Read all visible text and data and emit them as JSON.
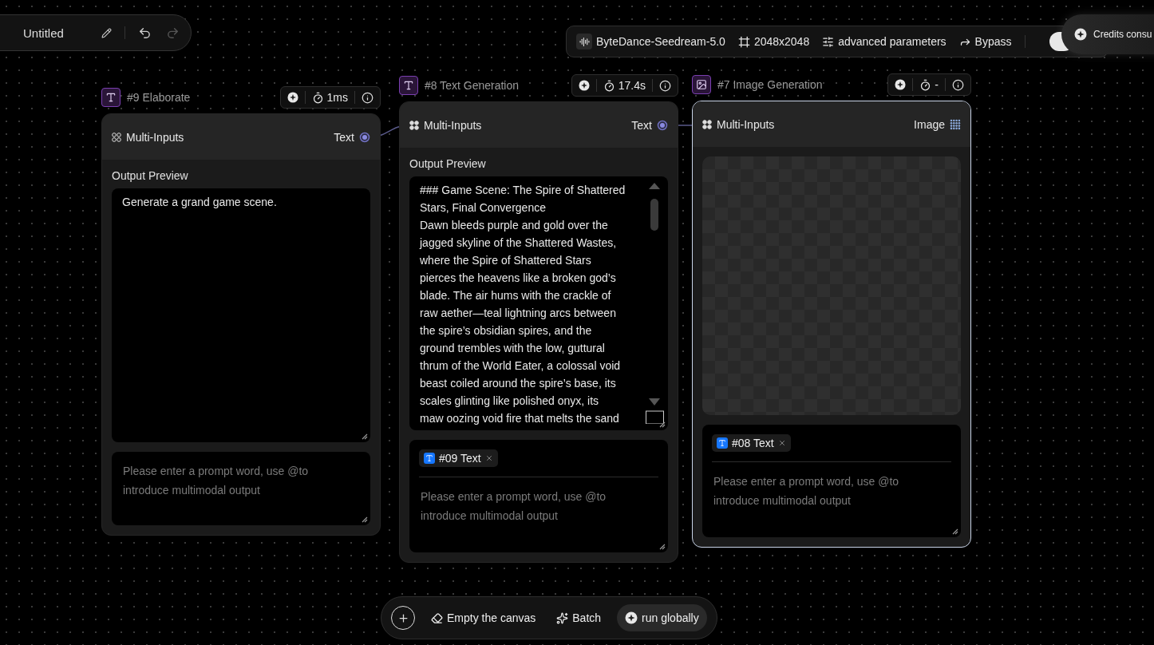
{
  "project_bar": {
    "title": "Untitled",
    "undo": {
      "disabled": false
    },
    "redo": {
      "disabled": true
    }
  },
  "model_bar": {
    "items": [
      {
        "kind": "model",
        "label": "ByteDance-Seedream-5.0"
      },
      {
        "kind": "size",
        "label": "2048x2048"
      },
      {
        "kind": "params",
        "label": "advanced parameters"
      },
      {
        "kind": "bypass",
        "label": "Bypass"
      }
    ],
    "toggle": {
      "on": true
    }
  },
  "credits_popup": {
    "label": "Credits consu"
  },
  "nodes": [
    {
      "kind": "text",
      "title": "#9 Elaborate",
      "time": "1ms",
      "selected": false,
      "inputs_label": "Multi-Inputs",
      "output_label": "Text",
      "preview_label": "Output Preview",
      "preview_text": "Generate a grand game scene.",
      "prompt_placeholder": "Please enter a prompt word, use @to introduce multimodal output"
    },
    {
      "kind": "text",
      "title": "#8 Text Generation",
      "time": "17.4s",
      "selected": false,
      "inputs_label": "Multi-Inputs",
      "output_label": "Text",
      "preview_label": "Output Preview",
      "preview_text": "### Game Scene: The Spire of Shattered\nStars, Final Convergence\nDawn bleeds purple and gold over the\njagged skyline of the Shattered Wastes,\nwhere the Spire of Shattered Stars\npierces the heavens like a broken god’s\nblade. The air hums with the crackle of\nraw aether—teal lightning arcs between\nthe spire’s obsidian spires, and the\nground trembles with the low, guttural\nthrum of the World Eater, a colossal void\nbeast coiled around the spire’s base, its\nscales glinting like polished onyx, its\nmaw oozing void fire that melts the sand",
      "chips": [
        {
          "label": "#09 Text"
        }
      ],
      "prompt_placeholder": "Please enter a prompt word, use @to introduce multimodal output"
    },
    {
      "kind": "image",
      "title": "#7 Image Generation",
      "time": "-",
      "selected": true,
      "inputs_label": "Multi-Inputs",
      "output_label": "Image",
      "chips": [
        {
          "label": "#08 Text"
        }
      ],
      "prompt_placeholder": "Please enter a prompt word, use @to introduce multimodal output"
    }
  ],
  "bottom_bar": {
    "actions": [
      {
        "kind": "add"
      },
      {
        "kind": "clear",
        "label": "Empty the canvas",
        "selected": false
      },
      {
        "kind": "batch",
        "label": "Batch",
        "selected": false
      },
      {
        "kind": "run",
        "label": "run globally",
        "selected": true
      }
    ]
  }
}
